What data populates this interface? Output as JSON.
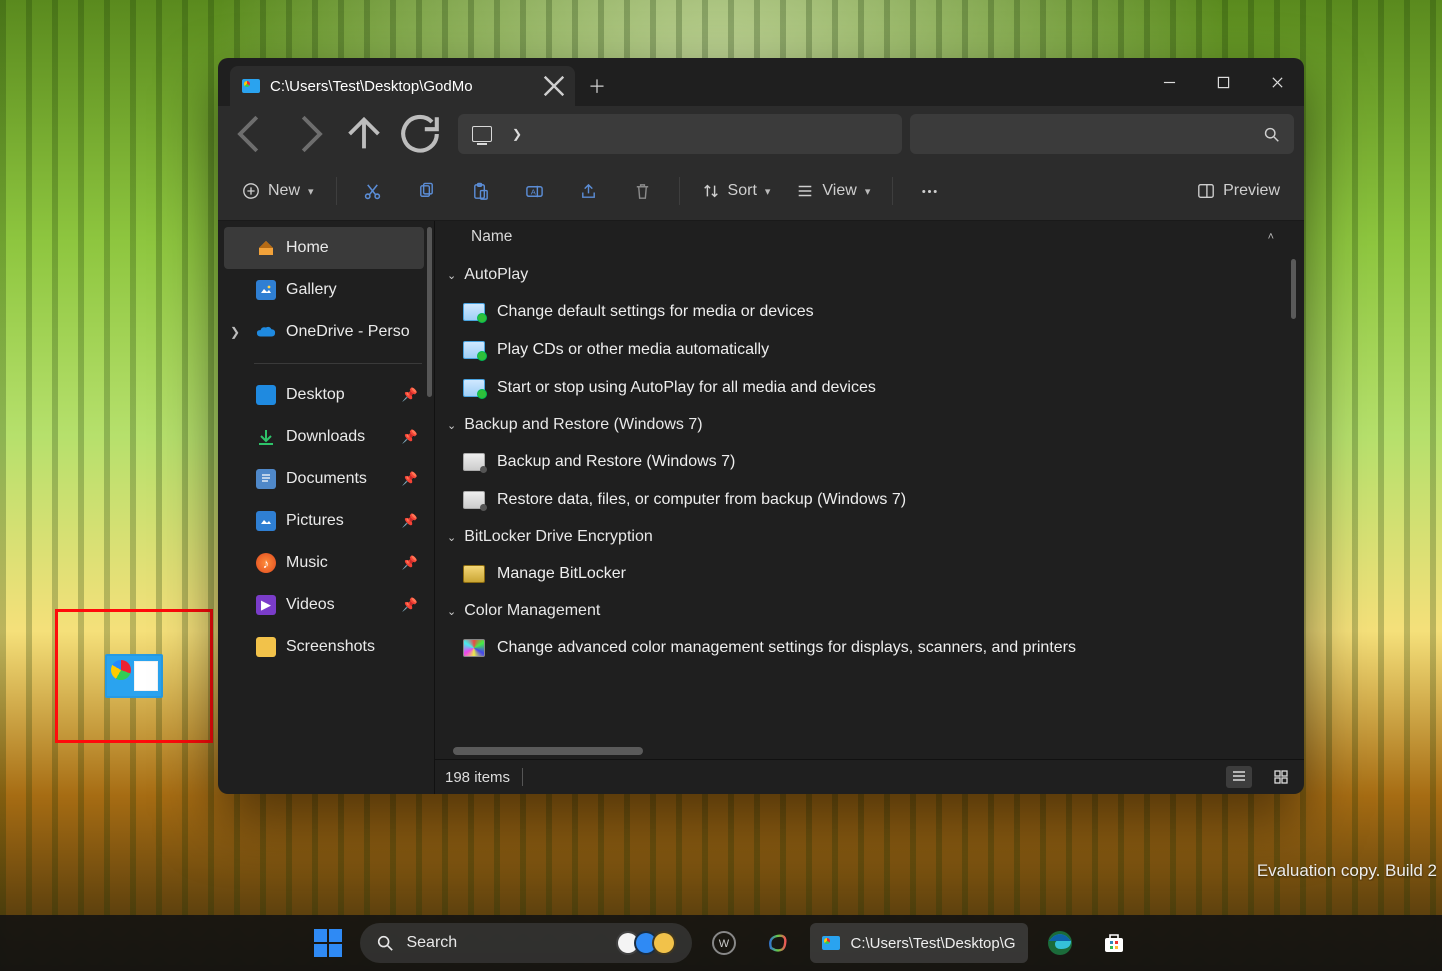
{
  "desktop": {
    "watermark": "Evaluation copy. Build 2"
  },
  "window": {
    "tab_title": "C:\\Users\\Test\\Desktop\\GodMo",
    "toolbar": {
      "new": "New",
      "sort": "Sort",
      "view": "View",
      "preview": "Preview"
    },
    "column": {
      "name": "Name"
    },
    "sidebar": {
      "home": "Home",
      "gallery": "Gallery",
      "onedrive": "OneDrive - Perso",
      "desktop": "Desktop",
      "downloads": "Downloads",
      "documents": "Documents",
      "pictures": "Pictures",
      "music": "Music",
      "videos": "Videos",
      "screenshots": "Screenshots"
    },
    "groups": [
      {
        "title": "AutoPlay",
        "items": [
          "Change default settings for media or devices",
          "Play CDs or other media automatically",
          "Start or stop using AutoPlay for all media and devices"
        ]
      },
      {
        "title": "Backup and Restore (Windows 7)",
        "items": [
          "Backup and Restore (Windows 7)",
          "Restore data, files, or computer from backup (Windows 7)"
        ]
      },
      {
        "title": "BitLocker Drive Encryption",
        "items": [
          "Manage BitLocker"
        ]
      },
      {
        "title": "Color Management",
        "items": [
          "Change advanced color management settings for displays, scanners, and printers"
        ]
      }
    ],
    "status": {
      "count": "198 items"
    }
  },
  "taskbar": {
    "search": "Search",
    "app": "C:\\Users\\Test\\Desktop\\G"
  }
}
